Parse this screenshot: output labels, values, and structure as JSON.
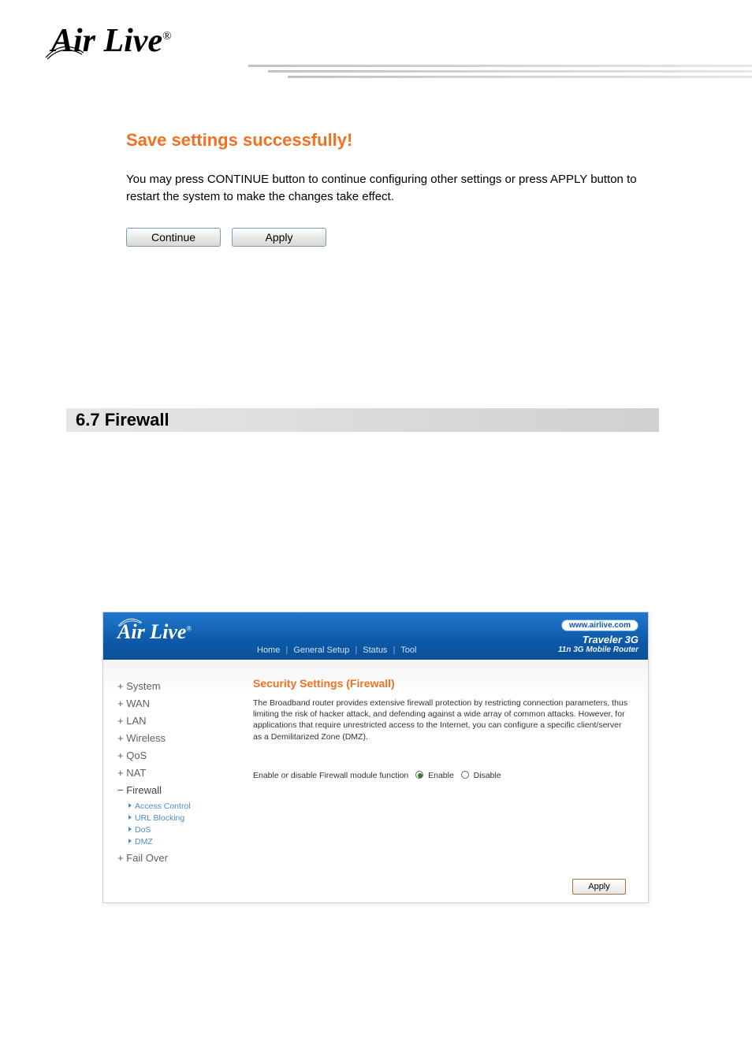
{
  "logo_text": "Air Live",
  "logo_registered": "®",
  "save_section": {
    "title": "Save settings successfully!",
    "body": "You may press CONTINUE button to continue configuring other settings or press APPLY button to restart the system to make the changes take effect.",
    "continue_label": "Continue",
    "apply_label": "Apply"
  },
  "section_heading": "6.7 Firewall",
  "router": {
    "logo": "Air Live",
    "logo_reg": "®",
    "url_badge": "www.airlive.com",
    "product": "Traveler 3G",
    "subtitle": "11n 3G Mobile Router",
    "nav": {
      "home": "Home",
      "general_setup": "General Setup",
      "status": "Status",
      "tool": "Tool"
    },
    "sidebar": {
      "items": [
        {
          "label": "System",
          "prefix": "+"
        },
        {
          "label": "WAN",
          "prefix": "+"
        },
        {
          "label": "LAN",
          "prefix": "+"
        },
        {
          "label": "Wireless",
          "prefix": "+"
        },
        {
          "label": "QoS",
          "prefix": "+"
        },
        {
          "label": "NAT",
          "prefix": "+"
        },
        {
          "label": "Firewall",
          "prefix": "−"
        },
        {
          "label": "Fail Over",
          "prefix": "+"
        }
      ],
      "firewall_sub": [
        "Access Control",
        "URL Blocking",
        "DoS",
        "DMZ"
      ]
    },
    "panel": {
      "title": "Security Settings (Firewall)",
      "desc": "The Broadband router provides extensive firewall protection by restricting connection parameters, thus limiting the risk of hacker attack, and defending against a wide array of common attacks. However, for applications that require unrestricted access to the Internet, you can configure a specific client/server as a Demilitarized Zone (DMZ).",
      "option_label": "Enable or disable Firewall module function",
      "enable_label": "Enable",
      "disable_label": "Disable",
      "apply_label": "Apply"
    }
  }
}
